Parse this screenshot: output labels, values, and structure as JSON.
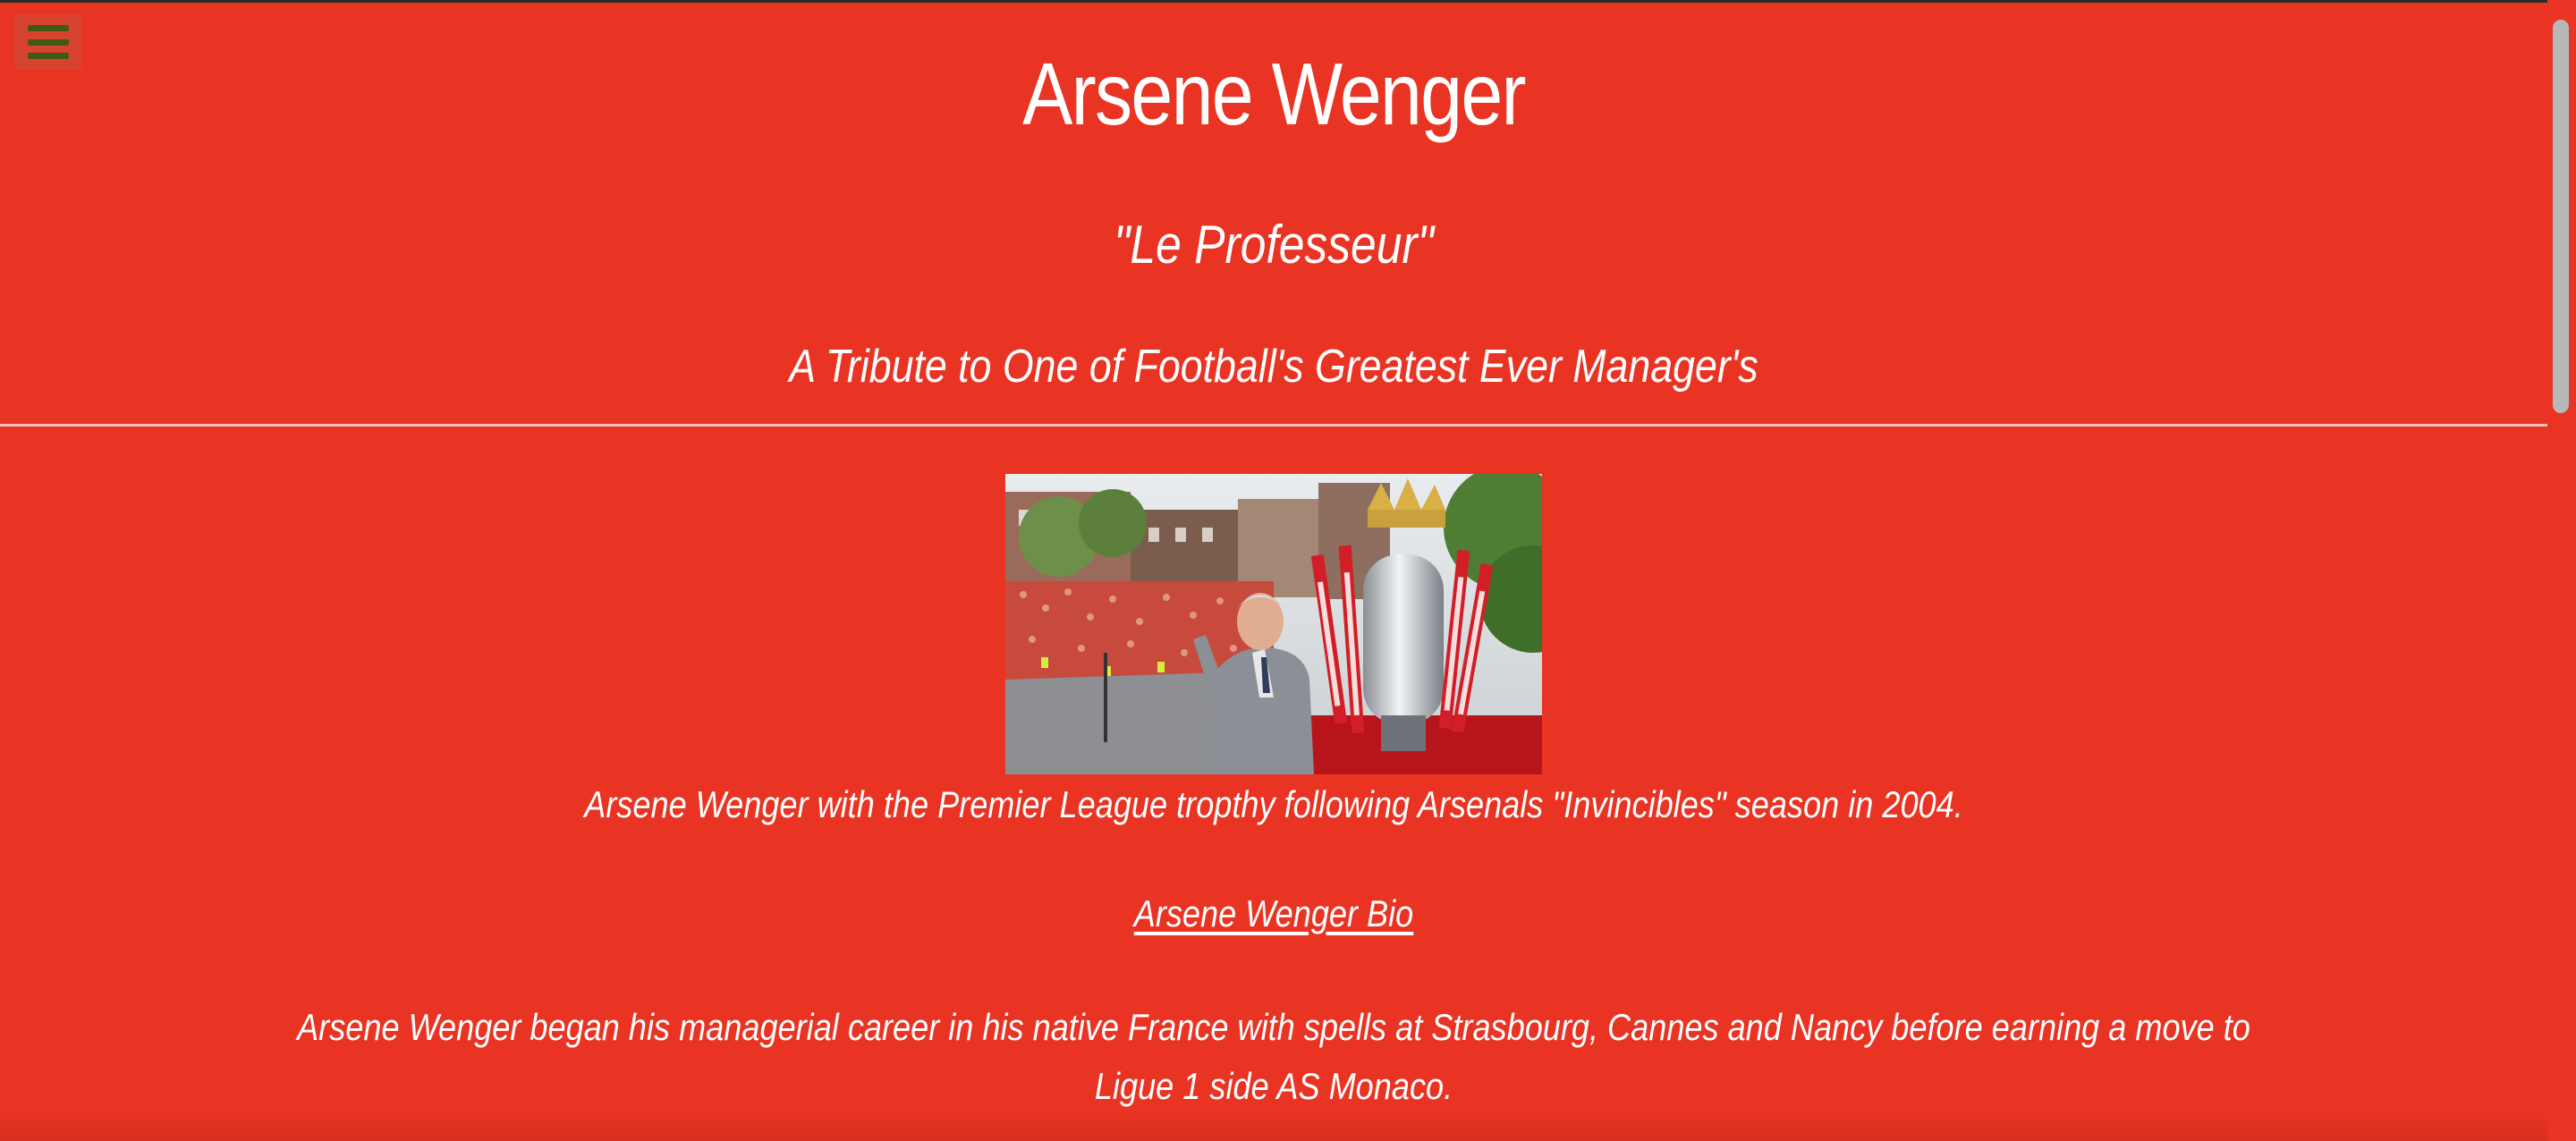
{
  "header": {
    "title": "Arsene Wenger",
    "subtitle": "\"Le Professeur\"",
    "tagline": "A Tribute to One of Football's Greatest Ever Manager's"
  },
  "menu": {
    "icon": "hamburger-menu-icon"
  },
  "photo": {
    "alt": "Arsene Wenger with the Premier League trophy"
  },
  "caption": "Arsene Wenger with the Premier League tropthy following Arsenals \"Invincibles\" season in 2004.",
  "bio_link": "Arsene Wenger Bio",
  "bio_text": "Arsene Wenger began his managerial career in his native France with spells at Strasbourg, Cannes and Nancy before earning a move to Ligue 1 side AS Monaco.",
  "colors": {
    "background": "#e93323",
    "text": "#ffffff",
    "menu_bars": "#3e5a14"
  }
}
